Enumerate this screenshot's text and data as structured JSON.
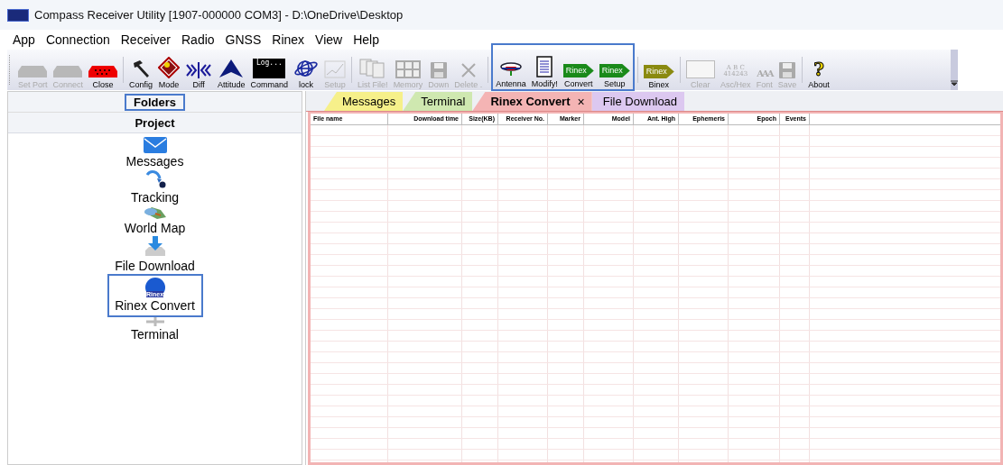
{
  "window": {
    "title": "Compass Receiver Utility [1907-000000 COM3] - D:\\OneDrive\\Desktop"
  },
  "menu": [
    "App",
    "Connection",
    "Receiver",
    "Radio",
    "GNSS",
    "Rinex",
    "View",
    "Help"
  ],
  "toolbar": [
    {
      "highlighted": false,
      "items": [
        {
          "label": "Set Port",
          "kind": "plug",
          "disabled": true
        },
        {
          "label": "Connect",
          "kind": "plug",
          "disabled": true
        },
        {
          "label": "Close",
          "kind": "plug",
          "disabled": false
        }
      ]
    },
    {
      "highlighted": false,
      "items": [
        {
          "label": "Config",
          "kind": "hammer",
          "disabled": false
        },
        {
          "label": "Mode",
          "kind": "diamond",
          "disabled": false
        },
        {
          "label": "Diff",
          "kind": "diff",
          "disabled": false
        },
        {
          "label": "Attitude",
          "kind": "peak",
          "disabled": false
        },
        {
          "label": "Command",
          "kind": "console",
          "icon_text": "Log...",
          "disabled": false
        },
        {
          "label": "lock",
          "kind": "globe",
          "disabled": false
        },
        {
          "label": "Setup",
          "kind": "graph",
          "disabled": true
        }
      ]
    },
    {
      "highlighted": false,
      "items": [
        {
          "label": "List File!",
          "kind": "docs",
          "disabled": true
        },
        {
          "label": "Memory",
          "kind": "grid",
          "disabled": true
        },
        {
          "label": "Down",
          "kind": "disk",
          "disabled": true
        },
        {
          "label": "Delete .",
          "kind": "cross",
          "disabled": true
        }
      ]
    },
    {
      "highlighted": true,
      "items": [
        {
          "label": "Antenna",
          "kind": "antenna",
          "disabled": false
        },
        {
          "label": "Modify!",
          "kind": "page",
          "disabled": false
        },
        {
          "label": "Convert",
          "kind": "arrow",
          "icon_text": "Rinex",
          "color": "#1a8a1a",
          "disabled": false
        },
        {
          "label": "Setup",
          "kind": "arrow",
          "icon_text": "Rinex",
          "color": "#1a8a1a",
          "disabled": false
        }
      ]
    },
    {
      "highlighted": false,
      "items": [
        {
          "label": "Binex",
          "kind": "arrow",
          "icon_text": "Rinex",
          "color": "#8a8a10",
          "disabled": false
        }
      ]
    },
    {
      "highlighted": false,
      "items": [
        {
          "label": "Clear",
          "kind": "blank",
          "disabled": true
        },
        {
          "label": "Asc/Hex",
          "kind": "abc",
          "icon_text": "A B C 414243",
          "disabled": true
        },
        {
          "label": "Font",
          "kind": "font",
          "icon_text": "AAA",
          "disabled": true
        },
        {
          "label": "Save",
          "kind": "disk",
          "disabled": true
        }
      ]
    },
    {
      "highlighted": false,
      "items": [
        {
          "label": "About",
          "kind": "help",
          "icon_text": "?",
          "disabled": false
        }
      ]
    }
  ],
  "sidebar": {
    "header": {
      "label": "Folders",
      "highlighted": true
    },
    "section": "Project",
    "items": [
      {
        "label": "Messages",
        "kind": "mail",
        "highlighted": false
      },
      {
        "label": "Tracking",
        "kind": "track",
        "highlighted": false
      },
      {
        "label": "World Map",
        "kind": "map",
        "highlighted": false
      },
      {
        "label": "File Download",
        "kind": "download",
        "highlighted": false
      },
      {
        "label": "Rinex Convert",
        "kind": "rinex",
        "icon_text": "Rinex",
        "highlighted": true
      },
      {
        "label": "Terminal",
        "kind": "terminal",
        "highlighted": false
      }
    ]
  },
  "tabs": [
    {
      "label": "Messages",
      "color": "#f6f08a",
      "selected": false,
      "closable": false
    },
    {
      "label": "Terminal",
      "color": "#cfe8b0",
      "selected": false,
      "closable": false
    },
    {
      "label": "Rinex Convert",
      "color": "#f4b4b4",
      "selected": true,
      "closable": true,
      "close": "×"
    },
    {
      "label": "File Download",
      "color": "#dcc8f0",
      "selected": false,
      "closable": false
    }
  ],
  "table": {
    "columns": [
      "File name",
      "Download time",
      "Size(KB)",
      "Receiver No.",
      "Marker",
      "Model",
      "Ant. High",
      "Ephemeris",
      "Epoch",
      "Events"
    ]
  }
}
